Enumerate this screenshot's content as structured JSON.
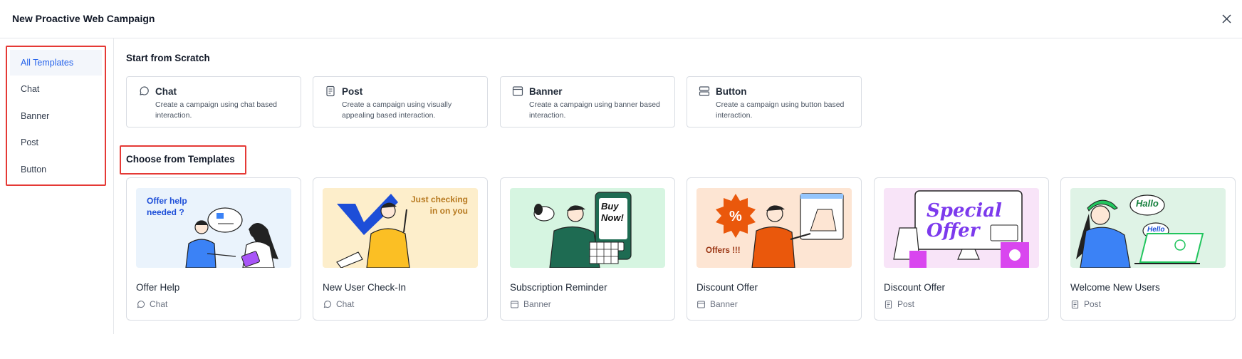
{
  "modal": {
    "title": "New Proactive Web Campaign"
  },
  "sidebar": {
    "items": [
      {
        "label": "All Templates",
        "active": true
      },
      {
        "label": "Chat"
      },
      {
        "label": "Banner"
      },
      {
        "label": "Post"
      },
      {
        "label": "Button"
      }
    ]
  },
  "scratch": {
    "heading": "Start from Scratch",
    "cards": [
      {
        "title": "Chat",
        "description": "Create a campaign using chat based interaction.",
        "icon": "chat-icon"
      },
      {
        "title": "Post",
        "description": "Create a campaign using visually appealing based interaction.",
        "icon": "post-icon"
      },
      {
        "title": "Banner",
        "description": "Create a campaign using banner based interaction.",
        "icon": "banner-icon"
      },
      {
        "title": "Button",
        "description": "Create a campaign using button based interaction.",
        "icon": "button-icon"
      }
    ]
  },
  "templates": {
    "heading": "Choose from Templates",
    "cards": [
      {
        "name": "Offer Help",
        "type": "Chat",
        "thumb_text": "Offer help\nneeded ?",
        "thumb_bg": "#eaf3fc"
      },
      {
        "name": "New User Check-In",
        "type": "Chat",
        "thumb_text": "Just checking\nin on you",
        "thumb_bg": "#fdeecb"
      },
      {
        "name": "Subscription Reminder",
        "type": "Banner",
        "thumb_text": "Buy\nNow!",
        "thumb_bg": "#d6f5e1"
      },
      {
        "name": "Discount Offer",
        "type": "Banner",
        "thumb_text": "Offers !!!",
        "thumb_bg": "#fde5d3"
      },
      {
        "name": "Discount Offer",
        "type": "Post",
        "thumb_text": "Special\nOffer",
        "thumb_bg": "#f8e4f8"
      },
      {
        "name": "Welcome New Users",
        "type": "Post",
        "thumb_text": "Hallo",
        "thumb_text_2": "Hello",
        "thumb_bg": "#dff3e6"
      }
    ]
  },
  "colors": {
    "accent": "#2563eb",
    "highlight": "#e53935"
  }
}
